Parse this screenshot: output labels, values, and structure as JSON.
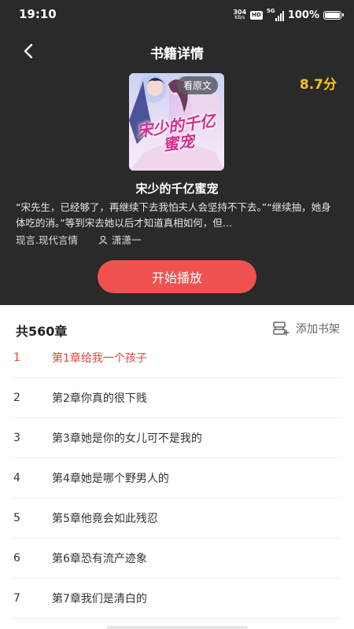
{
  "status_bar": {
    "time": "19:10",
    "net_speed_value": "304",
    "net_speed_unit": "KB/s",
    "hd_label": "HD",
    "network": "5G",
    "battery_percent": "100%",
    "battery_level": 1.0
  },
  "header": {
    "title": "书籍详情",
    "rating": "8.7分"
  },
  "book": {
    "cover_badge": "看原文",
    "cover_title": "宋少的千亿蜜宠",
    "name": "宋少的千亿蜜宠",
    "synopsis": "“宋先生，已经够了，再继续下去我怕夫人会坚持不下去。”“继续抽，她身体吃的消。”等到宋去她以后才知道真相如何，但…",
    "category": "现言.现代言情",
    "author": "潇潇一"
  },
  "actions": {
    "play_label": "开始播放",
    "add_shelf_label": "添加书架"
  },
  "chapter_list": {
    "count_label": "共560章",
    "items": [
      {
        "num": "1",
        "title": "第1章给我一个孩子",
        "active": true
      },
      {
        "num": "2",
        "title": "第2章你真的很下贱",
        "active": false
      },
      {
        "num": "3",
        "title": "第3章她是你的女儿可不是我的",
        "active": false
      },
      {
        "num": "4",
        "title": "第4章她是哪个野男人的",
        "active": false
      },
      {
        "num": "5",
        "title": "第5章他竟会如此残忍",
        "active": false
      },
      {
        "num": "6",
        "title": "第6章恐有流产迹象",
        "active": false
      },
      {
        "num": "7",
        "title": "第7章我们是清白的",
        "active": false
      }
    ]
  },
  "colors": {
    "header_bg": "#2a2a2a",
    "accent_red": "#f0524f",
    "rating_yellow": "#f7c31a",
    "active_chapter": "#e0463f"
  }
}
